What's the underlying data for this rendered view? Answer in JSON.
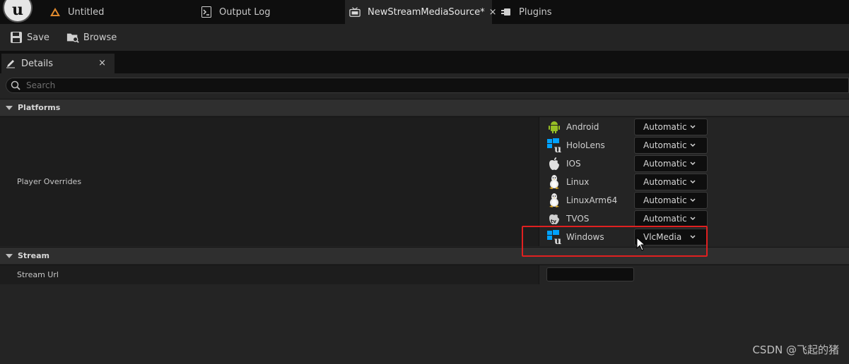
{
  "tabs": [
    {
      "label": "Untitled",
      "icon": "level-icon"
    },
    {
      "label": "Output Log",
      "icon": "terminal-icon"
    },
    {
      "label": "NewStreamMediaSource*",
      "icon": "media-source-icon",
      "close": "×"
    },
    {
      "label": "Plugins",
      "icon": "plugins-icon"
    }
  ],
  "toolbar": {
    "save_label": "Save",
    "browse_label": "Browse"
  },
  "details": {
    "tab_label": "Details",
    "tab_close": "×",
    "search_placeholder": "Search",
    "categories": {
      "platforms": "Platforms",
      "stream": "Stream"
    },
    "player_overrides_label": "Player Overrides",
    "platforms": [
      {
        "name": "Android",
        "value": "Automatic",
        "icon": "android-icon"
      },
      {
        "name": "HoloLens",
        "value": "Automatic",
        "icon": "hololens-icon"
      },
      {
        "name": "IOS",
        "value": "Automatic",
        "icon": "apple-icon"
      },
      {
        "name": "Linux",
        "value": "Automatic",
        "icon": "linux-icon"
      },
      {
        "name": "LinuxArm64",
        "value": "Automatic",
        "icon": "linux-icon"
      },
      {
        "name": "TVOS",
        "value": "Automatic",
        "icon": "appletv-icon"
      },
      {
        "name": "Windows",
        "value": "VlcMedia",
        "icon": "windows-icon"
      }
    ],
    "stream_url_label": "Stream Url",
    "stream_url_value": ""
  },
  "watermark": "CSDN @飞起的猪",
  "colors": {
    "highlight": "#e02020",
    "accent_blue": "#00a2ff",
    "android_green": "#97c024"
  }
}
